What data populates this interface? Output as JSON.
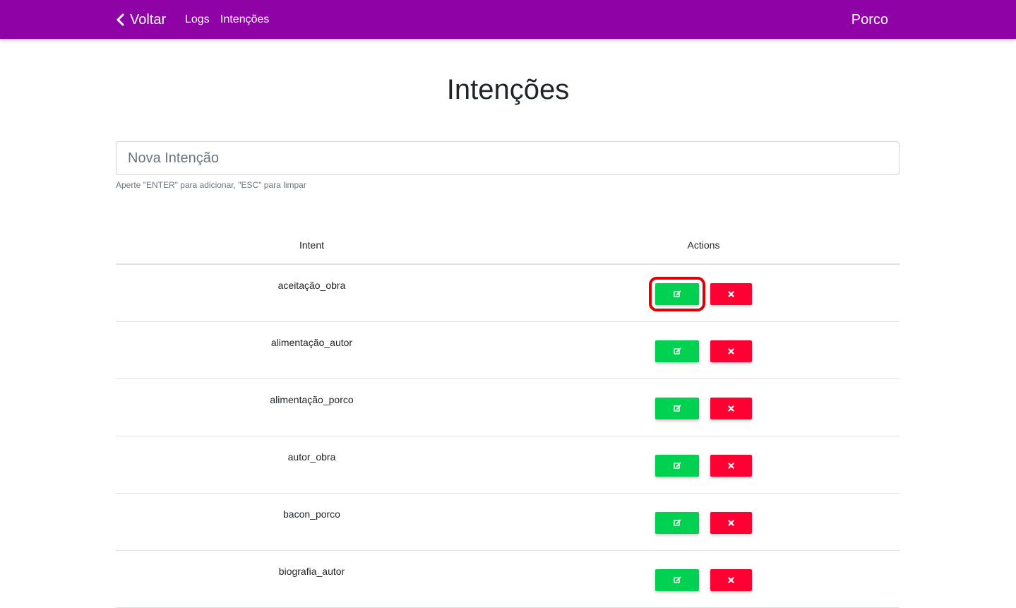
{
  "navbar": {
    "back_label": "Voltar",
    "links": [
      "Logs",
      "Intenções"
    ],
    "brand": "Porco",
    "color": "#8e02a6"
  },
  "page": {
    "title": "Intenções"
  },
  "new_intent": {
    "placeholder": "Nova Intenção",
    "value": "",
    "help": "Aperte \"ENTER\" para adicionar, \"ESC\" para limpar"
  },
  "table": {
    "headers": [
      "Intent",
      "Actions"
    ],
    "rows": [
      {
        "intent": "aceitação_obra"
      },
      {
        "intent": "alimentação_autor"
      },
      {
        "intent": "alimentação_porco"
      },
      {
        "intent": "autor_obra"
      },
      {
        "intent": "bacon_porco"
      },
      {
        "intent": "biografia_autor"
      }
    ],
    "edit_icon": "edit-icon",
    "delete_icon": "close-icon",
    "edit_color": "#00d150",
    "delete_color": "#ff0033",
    "highlight_color": "#e00000"
  }
}
